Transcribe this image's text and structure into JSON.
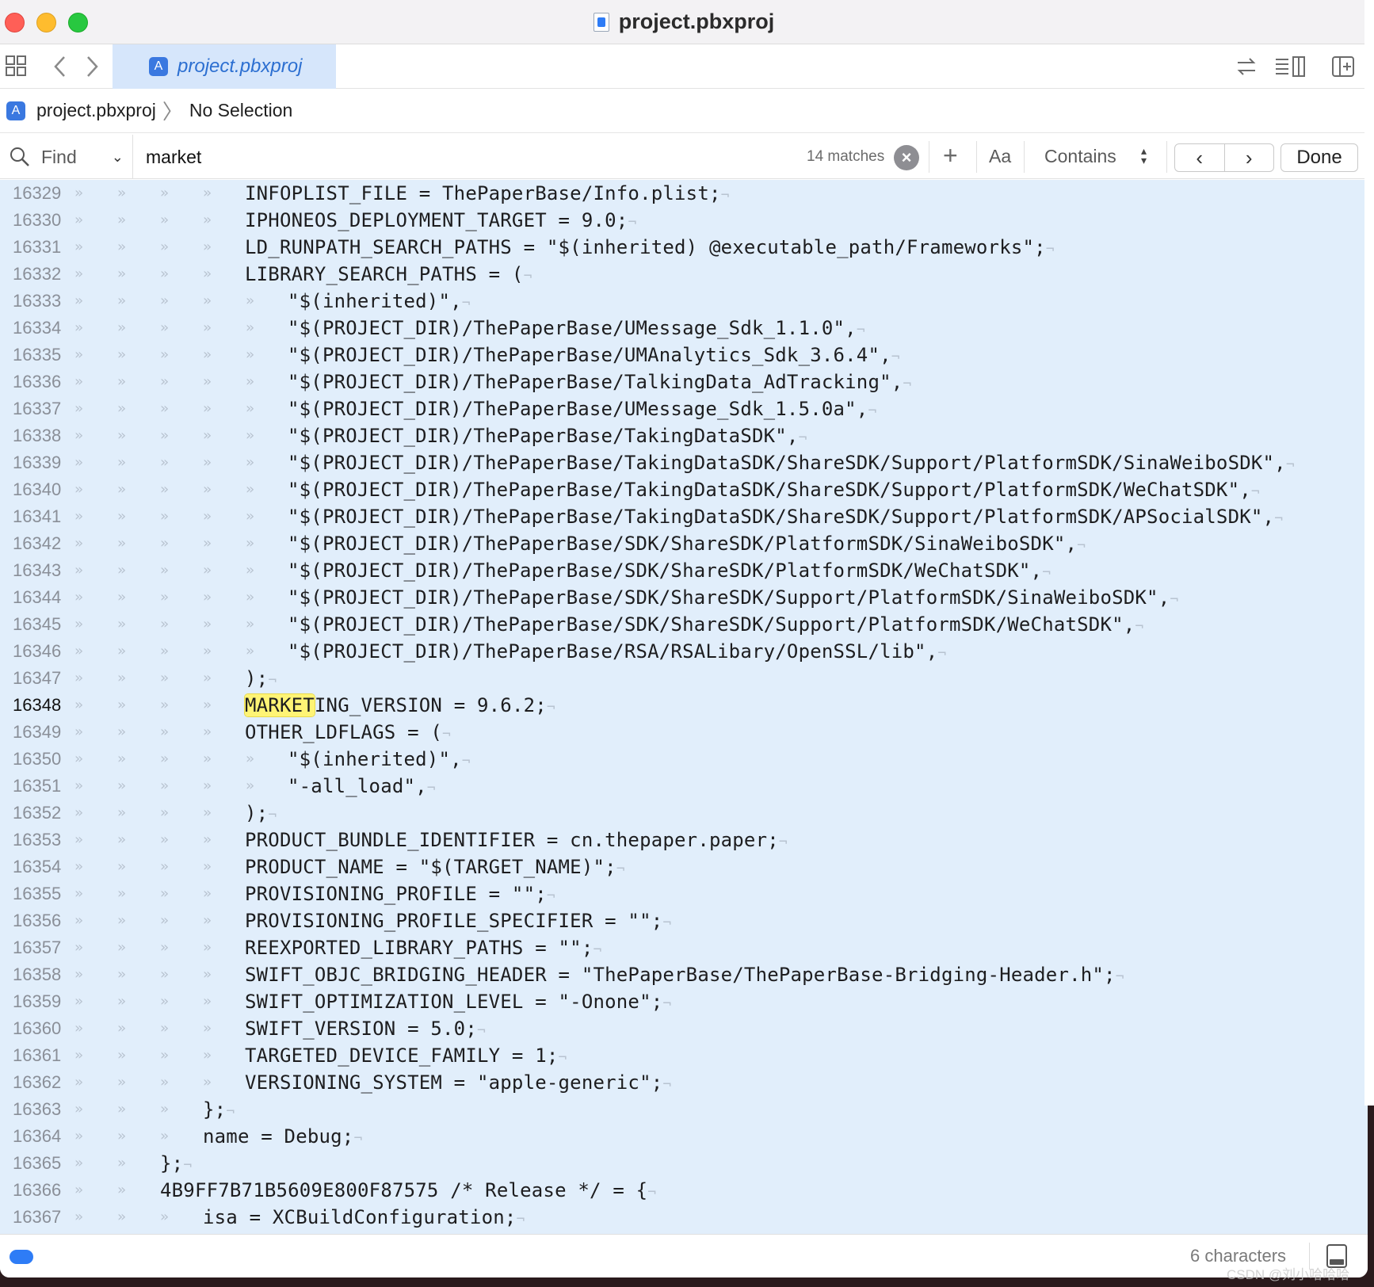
{
  "window": {
    "title": "project.pbxproj"
  },
  "tabbar": {
    "tab_label": "project.pbxproj"
  },
  "breadcrumb": {
    "file": "project.pbxproj",
    "selection": "No Selection"
  },
  "findbar": {
    "mode_label": "Find",
    "query": "market",
    "matches": "14 matches",
    "case_label": "Aa",
    "match_type": "Contains",
    "done_label": "Done"
  },
  "editor": {
    "current_line": 16348,
    "highlight_text": "MARKET",
    "lines": [
      {
        "n": 16329,
        "indent": 4,
        "text": "INFOPLIST_FILE = ThePaperBase/Info.plist;"
      },
      {
        "n": 16330,
        "indent": 4,
        "text": "IPHONEOS_DEPLOYMENT_TARGET = 9.0;"
      },
      {
        "n": 16331,
        "indent": 4,
        "text": "LD_RUNPATH_SEARCH_PATHS = \"$(inherited) @executable_path/Frameworks\";"
      },
      {
        "n": 16332,
        "indent": 4,
        "text": "LIBRARY_SEARCH_PATHS = ("
      },
      {
        "n": 16333,
        "indent": 5,
        "text": "\"$(inherited)\","
      },
      {
        "n": 16334,
        "indent": 5,
        "text": "\"$(PROJECT_DIR)/ThePaperBase/UMessage_Sdk_1.1.0\","
      },
      {
        "n": 16335,
        "indent": 5,
        "text": "\"$(PROJECT_DIR)/ThePaperBase/UMAnalytics_Sdk_3.6.4\","
      },
      {
        "n": 16336,
        "indent": 5,
        "text": "\"$(PROJECT_DIR)/ThePaperBase/TalkingData_AdTracking\","
      },
      {
        "n": 16337,
        "indent": 5,
        "text": "\"$(PROJECT_DIR)/ThePaperBase/UMessage_Sdk_1.5.0a\","
      },
      {
        "n": 16338,
        "indent": 5,
        "text": "\"$(PROJECT_DIR)/ThePaperBase/TakingDataSDK\","
      },
      {
        "n": 16339,
        "indent": 5,
        "text": "\"$(PROJECT_DIR)/ThePaperBase/TakingDataSDK/ShareSDK/Support/PlatformSDK/SinaWeiboSDK\","
      },
      {
        "n": 16340,
        "indent": 5,
        "text": "\"$(PROJECT_DIR)/ThePaperBase/TakingDataSDK/ShareSDK/Support/PlatformSDK/WeChatSDK\","
      },
      {
        "n": 16341,
        "indent": 5,
        "text": "\"$(PROJECT_DIR)/ThePaperBase/TakingDataSDK/ShareSDK/Support/PlatformSDK/APSocialSDK\","
      },
      {
        "n": 16342,
        "indent": 5,
        "text": "\"$(PROJECT_DIR)/ThePaperBase/SDK/ShareSDK/PlatformSDK/SinaWeiboSDK\","
      },
      {
        "n": 16343,
        "indent": 5,
        "text": "\"$(PROJECT_DIR)/ThePaperBase/SDK/ShareSDK/PlatformSDK/WeChatSDK\","
      },
      {
        "n": 16344,
        "indent": 5,
        "text": "\"$(PROJECT_DIR)/ThePaperBase/SDK/ShareSDK/Support/PlatformSDK/SinaWeiboSDK\","
      },
      {
        "n": 16345,
        "indent": 5,
        "text": "\"$(PROJECT_DIR)/ThePaperBase/SDK/ShareSDK/Support/PlatformSDK/WeChatSDK\","
      },
      {
        "n": 16346,
        "indent": 5,
        "text": "\"$(PROJECT_DIR)/ThePaperBase/RSA/RSALibary/OpenSSL/lib\","
      },
      {
        "n": 16347,
        "indent": 4,
        "text": ");"
      },
      {
        "n": 16348,
        "indent": 4,
        "text": "MARKETING_VERSION = 9.6.2;"
      },
      {
        "n": 16349,
        "indent": 4,
        "text": "OTHER_LDFLAGS = ("
      },
      {
        "n": 16350,
        "indent": 5,
        "text": "\"$(inherited)\","
      },
      {
        "n": 16351,
        "indent": 5,
        "text": "\"-all_load\","
      },
      {
        "n": 16352,
        "indent": 4,
        "text": ");"
      },
      {
        "n": 16353,
        "indent": 4,
        "text": "PRODUCT_BUNDLE_IDENTIFIER = cn.thepaper.paper;"
      },
      {
        "n": 16354,
        "indent": 4,
        "text": "PRODUCT_NAME = \"$(TARGET_NAME)\";"
      },
      {
        "n": 16355,
        "indent": 4,
        "text": "PROVISIONING_PROFILE = \"\";"
      },
      {
        "n": 16356,
        "indent": 4,
        "text": "PROVISIONING_PROFILE_SPECIFIER = \"\";"
      },
      {
        "n": 16357,
        "indent": 4,
        "text": "REEXPORTED_LIBRARY_PATHS = \"\";"
      },
      {
        "n": 16358,
        "indent": 4,
        "text": "SWIFT_OBJC_BRIDGING_HEADER = \"ThePaperBase/ThePaperBase-Bridging-Header.h\";"
      },
      {
        "n": 16359,
        "indent": 4,
        "text": "SWIFT_OPTIMIZATION_LEVEL = \"-Onone\";"
      },
      {
        "n": 16360,
        "indent": 4,
        "text": "SWIFT_VERSION = 5.0;"
      },
      {
        "n": 16361,
        "indent": 4,
        "text": "TARGETED_DEVICE_FAMILY = 1;"
      },
      {
        "n": 16362,
        "indent": 4,
        "text": "VERSIONING_SYSTEM = \"apple-generic\";"
      },
      {
        "n": 16363,
        "indent": 3,
        "text": "};"
      },
      {
        "n": 16364,
        "indent": 3,
        "text": "name = Debug;"
      },
      {
        "n": 16365,
        "indent": 2,
        "text": "};"
      },
      {
        "n": 16366,
        "indent": 2,
        "text": "4B9FF7B71B5609E800F87575 /* Release */ = {"
      },
      {
        "n": 16367,
        "indent": 3,
        "text": "isa = XCBuildConfiguration;"
      }
    ]
  },
  "statusbar": {
    "char_count": "6 characters"
  },
  "watermark": "CSDN @刘小哈哈哈",
  "colors": {
    "editor_bg": "#e1eefb",
    "highlight": "#fff475",
    "accent": "#2e7cf6"
  }
}
